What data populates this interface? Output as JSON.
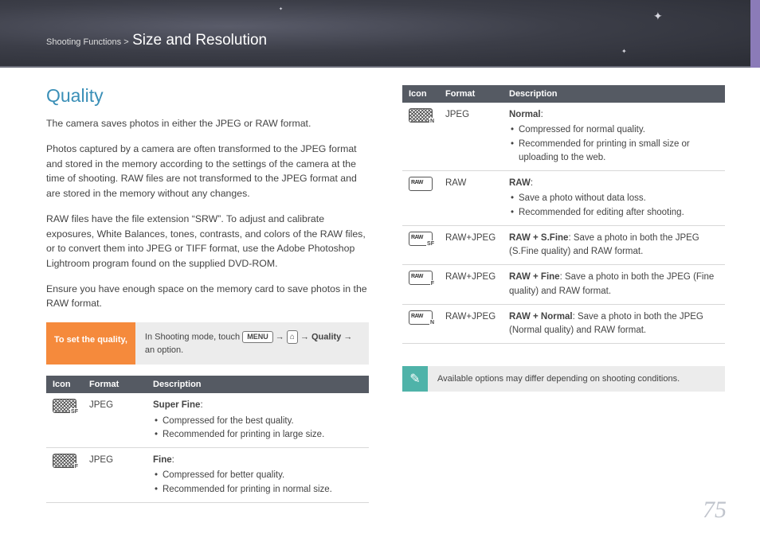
{
  "breadcrumb": {
    "prefix": "Shooting Functions >",
    "title": "Size and Resolution"
  },
  "section_title": "Quality",
  "paragraphs": {
    "p1": "The camera saves photos in either the JPEG or RAW format.",
    "p2": "Photos captured by a camera are often transformed to the JPEG format and stored in the memory according to the settings of the camera at the time of shooting. RAW files are not transformed to the JPEG format and are stored in the memory without any changes.",
    "p3": "RAW files have the file extension “SRW”. To adjust and calibrate exposures, White Balances, tones, contrasts, and colors of the RAW files, or to convert them into JPEG or TIFF format, use the Adobe Photoshop Lightroom program found on the supplied DVD-ROM.",
    "p4": "Ensure you have enough space on the memory card to save photos in the RAW format."
  },
  "setbox": {
    "label": "To set the quality,",
    "text_prefix": "In Shooting mode, touch ",
    "menu": "MENU",
    "arrow": "→",
    "bold": "Quality",
    "text_suffix": " an option."
  },
  "table_headers": {
    "icon": "Icon",
    "format": "Format",
    "desc": "Description"
  },
  "left_rows": [
    {
      "format": "JPEG",
      "title": "Super Fine",
      "points": [
        "Compressed for the best quality.",
        "Recommended for printing in large size."
      ]
    },
    {
      "format": "JPEG",
      "title": "Fine",
      "points": [
        "Compressed for better quality.",
        "Recommended for printing in normal size."
      ]
    }
  ],
  "right_rows": [
    {
      "format": "JPEG",
      "title": "Normal",
      "points": [
        "Compressed for normal quality.",
        "Recommended for printing in small size or uploading to the web."
      ]
    },
    {
      "format": "RAW",
      "title": "RAW",
      "points": [
        "Save a photo without data loss.",
        "Recommended for editing after shooting."
      ]
    },
    {
      "format": "RAW+JPEG",
      "inline": "RAW + S.Fine: Save a photo in both the JPEG (S.Fine quality) and RAW format."
    },
    {
      "format": "RAW+JPEG",
      "inline": "RAW + Fine: Save a photo in both the JPEG (Fine quality) and RAW format."
    },
    {
      "format": "RAW+JPEG",
      "inline": "RAW + Normal: Save a photo in both the JPEG (Normal quality) and RAW format."
    }
  ],
  "inline_bold": [
    "RAW + S.Fine",
    "RAW + Fine",
    "RAW + Normal"
  ],
  "note": "Available options may differ depending on shooting conditions.",
  "page_number": "75"
}
